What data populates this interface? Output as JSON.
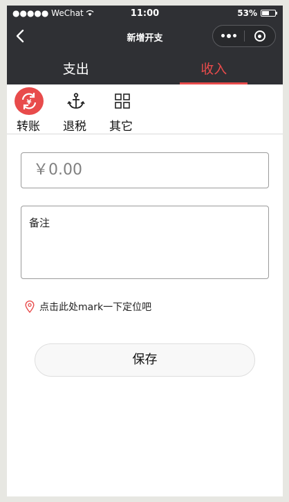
{
  "status_bar": {
    "carrier": "●●●●● WeChat",
    "time": "11:00",
    "battery": "53%",
    "battery_level": 0.53
  },
  "nav": {
    "title": "新增开支",
    "back_icon": "chevron-left-icon",
    "more_icon": "more-dots-icon",
    "close_icon": "target-circle-icon"
  },
  "tabs": [
    {
      "label": "支出",
      "active": false
    },
    {
      "label": "收入",
      "active": true
    }
  ],
  "categories": [
    {
      "label": "转账",
      "icon": "yen-exchange-icon",
      "active": true
    },
    {
      "label": "退税",
      "icon": "anchor-icon",
      "active": false
    },
    {
      "label": "其它",
      "icon": "grid-icon",
      "active": false
    }
  ],
  "form": {
    "amount_placeholder": "￥0.00",
    "note_placeholder": "备注",
    "location_text": "点击此处mark一下定位吧",
    "save_label": "保存"
  },
  "colors": {
    "accent": "#e84b4b",
    "header_bg": "#2f3034"
  }
}
